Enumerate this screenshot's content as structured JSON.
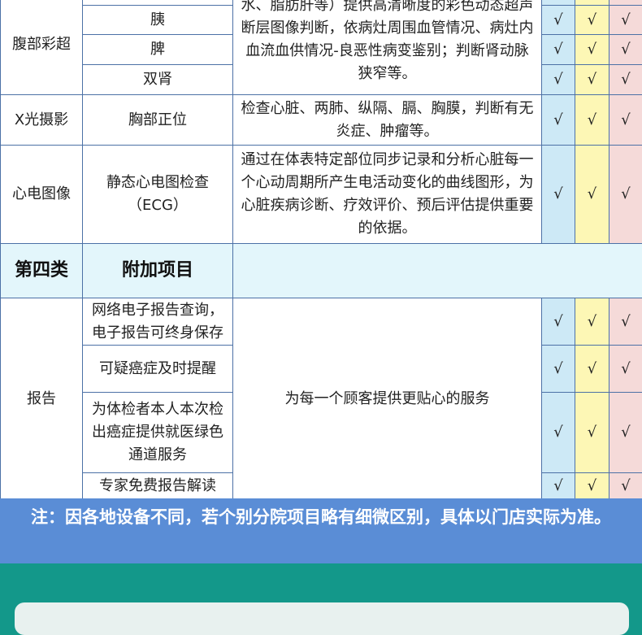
{
  "rows": {
    "ultrasound": {
      "category": "腹部彩超",
      "items": [
        "",
        "胰",
        "脾",
        "双肾"
      ],
      "desc": "水、脂肪肝等）提供高清晰度的彩色动态超声断层图像判断，依病灶周围血管情况、病灶内血流血供情况-良恶性病变鉴别；判断肾动脉狭窄等。"
    },
    "xray": {
      "category": "X光摄影",
      "item": "胸部正位",
      "desc": "检查心脏、两肺、纵隔、膈、胸膜，判断有无炎症、肿瘤等。"
    },
    "ecg": {
      "category": "心电图像",
      "item": "静态心电图检查（ECG）",
      "desc": "通过在体表特定部位同步记录和分析心脏每一个心动周期所产生电活动变化的曲线图形，为心脏疾病诊断、疗效评价、预后评估提供重要的依据。"
    },
    "section4": {
      "category": "第四类",
      "title": "附加项目"
    },
    "report": {
      "category": "报告",
      "items": [
        "网络电子报告查询，电子报告可终身保存",
        "可疑癌症及时提醒",
        "为体检者本人本次检出癌症提供就医绿色通道服务",
        "专家免费报告解读"
      ],
      "desc": "为每一个顾客提供更贴心的服务"
    }
  },
  "check": "√",
  "note": "注：因各地设备不同，若个别分院项目略有细微区别，具体以门店实际为准。",
  "colors": {
    "teal": "#13988a",
    "note_bg": "#5a8dd6",
    "col_blue": "#cde9f6",
    "col_yellow": "#fdf7b5",
    "col_pink": "#f5dad9"
  }
}
